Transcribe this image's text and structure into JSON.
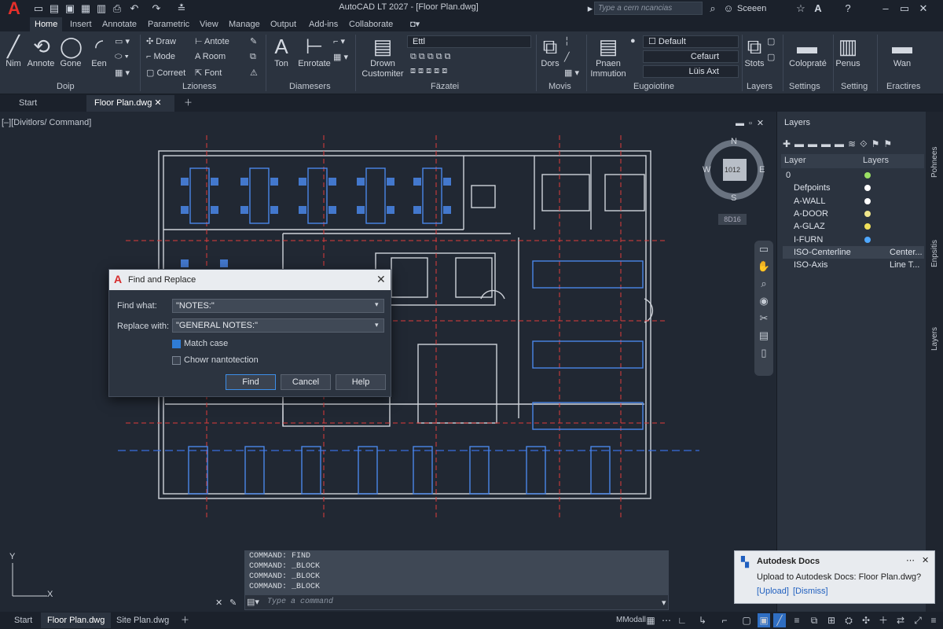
{
  "app": {
    "title": "AutoCAD LT 2027 - [Floor Plan.dwg]",
    "logo": "A",
    "search_placeholder": "Type a cern ncancias",
    "user": "Sceeen"
  },
  "menus": [
    "Home",
    "Insert",
    "Annotate",
    "Parametric",
    "View",
    "Manage",
    "Output",
    "Add-ins",
    "Collaborate"
  ],
  "ribbon": {
    "draw": {
      "tools": [
        "Nim",
        "Annote",
        "Gone",
        "Een"
      ],
      "label": "Doip"
    },
    "modify": {
      "items": [
        "Draw",
        "Mode",
        "Correet"
      ],
      "items2": [
        "Antote",
        "Room",
        "Font"
      ],
      "label": "Lzioness"
    },
    "annot": {
      "tools": [
        "Ton",
        "Enrotate"
      ],
      "label": "Diamesers"
    },
    "block": {
      "tools": [
        "Drown",
        "Customiter"
      ],
      "combo": "Ettl",
      "label": "Fäzatei"
    },
    "movis": {
      "tools": [
        "Dors"
      ],
      "label": "Movis"
    },
    "props": {
      "tools": [
        "Pnaen",
        "Immution"
      ],
      "combo1": "Default",
      "combo2": "Cefaurt",
      "combo3": "Lüis Axt",
      "label": "Eugoiotine"
    },
    "layers": {
      "tool": "Stots",
      "label": "Layers"
    },
    "settings": {
      "tool": "Colopraté",
      "label": "Settings"
    },
    "setting2": {
      "tool": "Penus",
      "label": "Setting"
    },
    "eractires": {
      "tool": "Wan",
      "label": "Eractires"
    }
  },
  "doc_tabs": [
    "Start",
    "Floor Plan.dwg"
  ],
  "viewport_label": "[–][Divitlors/ Command]",
  "viewcube": {
    "n": "N",
    "s": "S",
    "e": "E",
    "w": "W",
    "center": "1012",
    "badge": "8D16"
  },
  "dialog": {
    "title": "Find and Replace",
    "find_label": "Find what:",
    "find_value": "\"NOTES:\"",
    "replace_label": "Replace with:",
    "replace_value": "\"GENERAL NOTES:\"",
    "match_case": "Match case",
    "chown": "Chowr nantotection",
    "find_btn": "Find",
    "cancel_btn": "Cancel",
    "help_btn": "Help"
  },
  "layers_panel": {
    "title": "Layers",
    "col1": "Layer",
    "col2": "Layers",
    "rows": [
      {
        "name": "0",
        "color": "#9be064",
        "value": ""
      },
      {
        "name": "Defpoints",
        "color": "#ffffff",
        "value": ""
      },
      {
        "name": "A-WALL",
        "color": "#ffffff",
        "value": ""
      },
      {
        "name": "A-DOOR",
        "color": "#f0e68c",
        "value": ""
      },
      {
        "name": "A-GLAZ",
        "color": "#f0e05a",
        "value": ""
      },
      {
        "name": "I-FURN",
        "color": "#4fa8ff",
        "value": ""
      },
      {
        "name": "ISO-Centerline",
        "color": "",
        "value": "Center..."
      },
      {
        "name": "ISO-Axis",
        "color": "",
        "value": "Line T..."
      }
    ]
  },
  "side_tabs": [
    "Pohnees",
    "Enpsitis",
    "Layers"
  ],
  "command": {
    "history": [
      "COMMAND: FIND",
      "COMMAND: _BLOCK",
      "COMMAND: _BLOCK",
      "COMMAND: _BLOCK"
    ],
    "placeholder": "Type a command"
  },
  "status_tabs": [
    "Start",
    "Floor Plan.dwg",
    "Site Plan.dwg"
  ],
  "status": {
    "model": "MModall"
  },
  "toast": {
    "title": "Autodesk Docs",
    "body": "Upload to Autodesk Docs: Floor Plan.dwg?",
    "upload": "[Upload]",
    "dismiss": "[Dismiss]"
  },
  "ucs": {
    "x": "X",
    "y": "Y"
  }
}
